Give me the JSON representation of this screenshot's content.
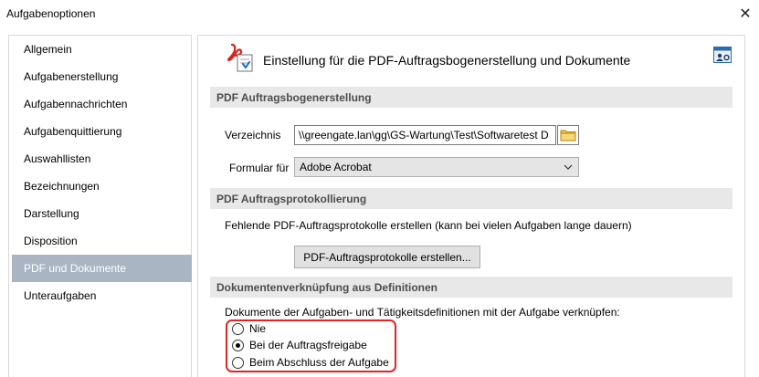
{
  "window": {
    "title": "Aufgabenoptionen",
    "close_glyph": "✕"
  },
  "sidebar": {
    "items": [
      {
        "label": "Allgemein"
      },
      {
        "label": "Aufgabenerstellung"
      },
      {
        "label": "Aufgabennachrichten"
      },
      {
        "label": "Aufgabenquittierung"
      },
      {
        "label": "Auswahllisten"
      },
      {
        "label": "Bezeichnungen"
      },
      {
        "label": "Darstellung"
      },
      {
        "label": "Disposition"
      },
      {
        "label": "PDF und Dokumente",
        "active": true
      },
      {
        "label": "Unteraufgaben"
      }
    ]
  },
  "header": {
    "title": "Einstellung für die PDF-Auftragsbogenerstellung und Dokumente",
    "icon": "pdf-document-icon",
    "help_icon": "settings-user-icon"
  },
  "sections": {
    "bogen": {
      "heading": "PDF Auftragsbogenerstellung",
      "directory_label": "Verzeichnis",
      "directory_value": "\\\\greengate.lan\\gg\\GS-Wartung\\Test\\Softwaretest D",
      "form_label": "Formular für",
      "form_value": "Adobe Acrobat"
    },
    "protokoll": {
      "heading": "PDF Auftragsprotokollierung",
      "description": "Fehlende PDF-Auftragsprotokolle erstellen (kann bei vielen Aufgaben lange dauern)",
      "button_label": "PDF-Auftragsprotokolle erstellen..."
    },
    "dokumente": {
      "heading": "Dokumentenverknüpfung aus Definitionen",
      "description": "Dokumente der Aufgaben- und Tätigkeitsdefinitionen mit der Aufgabe verknüpfen:",
      "options": [
        {
          "label": "Nie",
          "checked": false
        },
        {
          "label": "Bei der Auftragsfreigabe",
          "checked": true
        },
        {
          "label": "Beim Abschluss der Aufgabe",
          "checked": false
        }
      ]
    }
  },
  "colors": {
    "active_nav": "#aab5c3",
    "section_bg": "#e8e8e8",
    "highlight_border": "#e02424",
    "pdf_red": "#d9241b"
  }
}
